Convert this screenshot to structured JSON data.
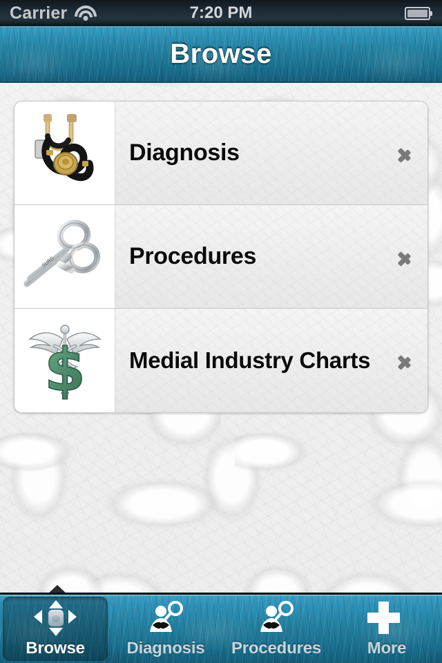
{
  "status_bar": {
    "carrier": "Carrier",
    "wifi_icon": "wifi-icon",
    "time": "7:20 PM",
    "battery_icon": "battery-icon"
  },
  "nav_bar": {
    "title": "Browse"
  },
  "colors": {
    "nav_blue_top": "#3ca0c4",
    "nav_blue_bottom": "#15607c",
    "tab_bar_blue": "#1e7ba3",
    "background_leather": "#f0f0f0",
    "cell_background": "#ececec",
    "chevron_gray": "#7a7a7a",
    "title_text": "#0a0a0a",
    "tab_label_inactive": "#c9d6dd",
    "tab_label_active": "#ffffff",
    "caduceus_green": "#4e8c6d"
  },
  "list": {
    "rows": [
      {
        "title": "Diagnosis",
        "thumb_icon": "stethoscope-icon",
        "accessory_icon": "chevron-right-icon"
      },
      {
        "title": "Procedures",
        "thumb_icon": "surgical-scissors-icon",
        "accessory_icon": "chevron-right-icon"
      },
      {
        "title": "Medial Industry Charts",
        "thumb_icon": "caduceus-dollar-icon",
        "accessory_icon": "chevron-right-icon"
      }
    ]
  },
  "tab_bar": {
    "selected_index": 0,
    "items": [
      {
        "label": "Browse",
        "icon": "dpad-icon",
        "selected": true
      },
      {
        "label": "Diagnosis",
        "icon": "person-search-icon",
        "selected": false
      },
      {
        "label": "Procedures",
        "icon": "person-search-icon",
        "selected": false
      },
      {
        "label": "More",
        "icon": "plus-icon",
        "selected": false
      }
    ]
  }
}
